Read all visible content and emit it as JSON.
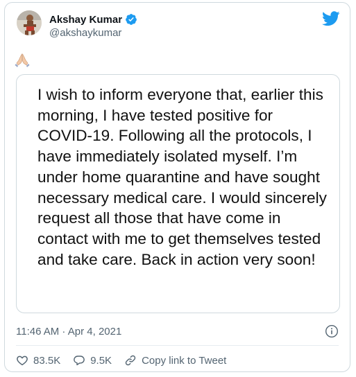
{
  "author": {
    "name": "Akshay Kumar",
    "handle": "@akshaykumar",
    "verified_icon": "verified-badge-icon"
  },
  "tweet": {
    "emoji": "🙏🏻",
    "statement_text": "I wish to inform everyone that, earlier this morning, I have tested positive for COVID-19. Following all the protocols, I have immediately isolated myself. I’m under home quarantine and have sought necessary medical care. I would sincerely request all those that have come in contact with me to get themselves tested and take care. Back in action very soon!",
    "timestamp": "11:46 AM · Apr 4, 2021"
  },
  "actions": {
    "likes": "83.5K",
    "replies": "9.5K",
    "copy_link_label": "Copy link to Tweet"
  },
  "colors": {
    "twitter_blue": "#1d9bf0",
    "secondary_text": "#536471",
    "border": "#cfd9de"
  }
}
